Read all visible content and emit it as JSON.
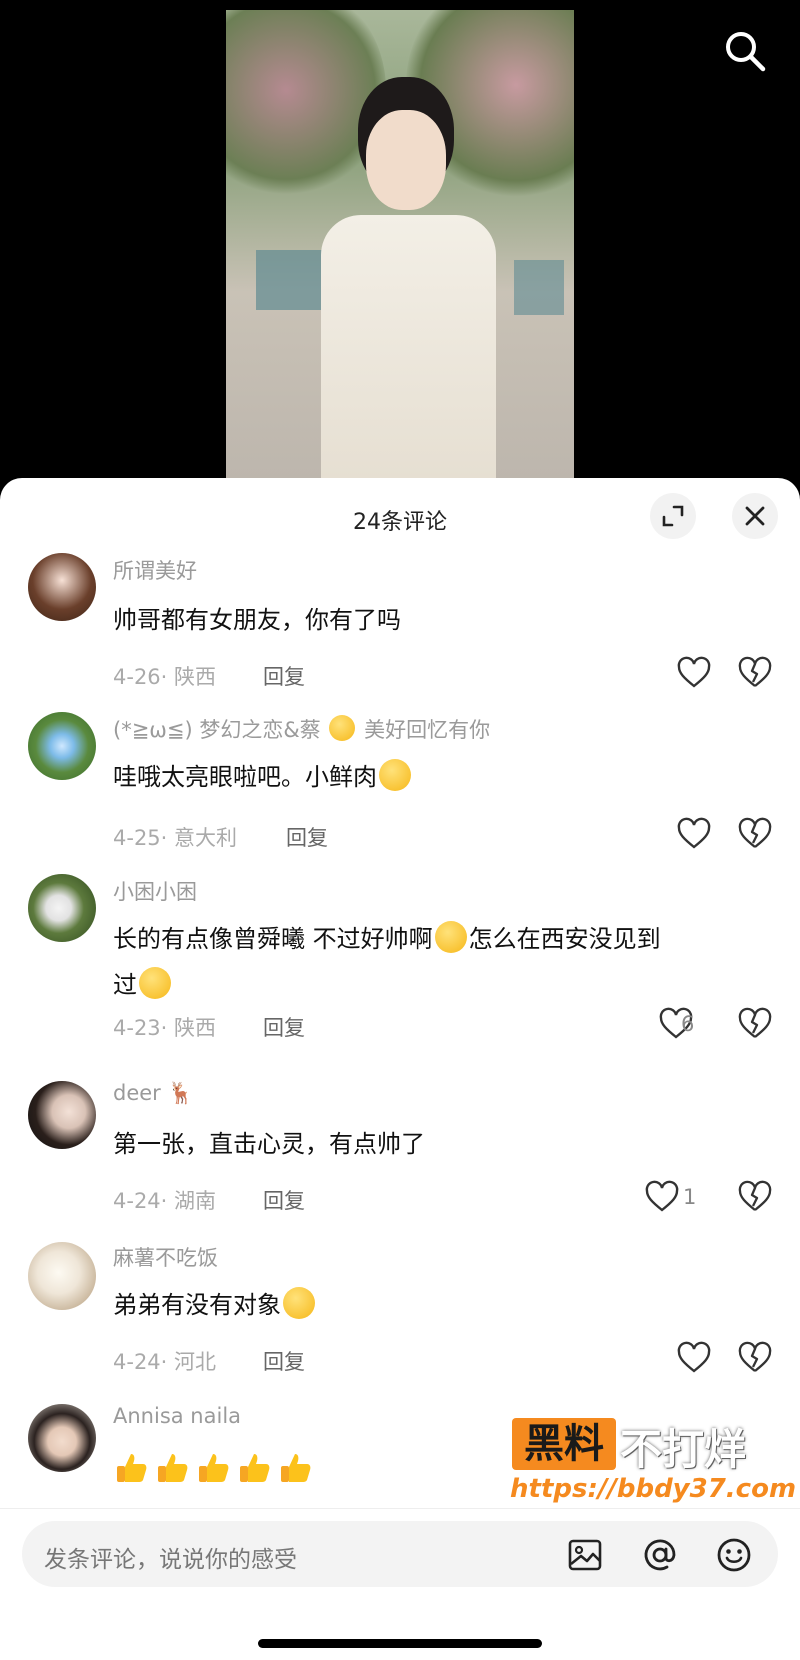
{
  "header": {
    "comment_count_title": "24条评论"
  },
  "comments": [
    {
      "username": "所谓美好",
      "text": "帅哥都有女朋友，你有了吗",
      "date": "4-26",
      "location": "陕西",
      "reply": "回复",
      "likes": ""
    },
    {
      "username": "(*≧ω≦) 梦幻之恋&蔡",
      "username_suffix": "美好回忆有你",
      "text": "哇哦太亮眼啦吧。小鲜肉",
      "date": "4-25",
      "location": "意大利",
      "reply": "回复",
      "likes": ""
    },
    {
      "username": "小困小困",
      "text_line1": "长的有点像曾舜曦  不过好帅啊",
      "text_line1b": "怎么在西安没见到",
      "text_line2": "过",
      "date": "4-23",
      "location": "陕西",
      "reply": "回复",
      "likes": "6"
    },
    {
      "username": "deer",
      "text": "第一张，直击心灵，有点帅了",
      "date": "4-24",
      "location": "湖南",
      "reply": "回复",
      "likes": "1"
    },
    {
      "username": "麻薯不吃饭",
      "text": "弟弟有没有对象",
      "date": "4-24",
      "location": "河北",
      "reply": "回复",
      "likes": ""
    },
    {
      "username": "Annisa naila",
      "text": ""
    }
  ],
  "input": {
    "placeholder": "发条评论，说说你的感受"
  },
  "watermark": {
    "brand": "黑料",
    "brand_suffix": "不打烊",
    "url": "https://bbdy37.com"
  },
  "icons": [
    "search-icon",
    "expand-icon",
    "close-icon",
    "heart-icon",
    "broken-heart-icon",
    "image-icon",
    "at-icon",
    "emoji-icon"
  ],
  "colors": {
    "accent": "#f58a1f",
    "sheet": "#ffffff",
    "meta": "#aaaaaa"
  }
}
